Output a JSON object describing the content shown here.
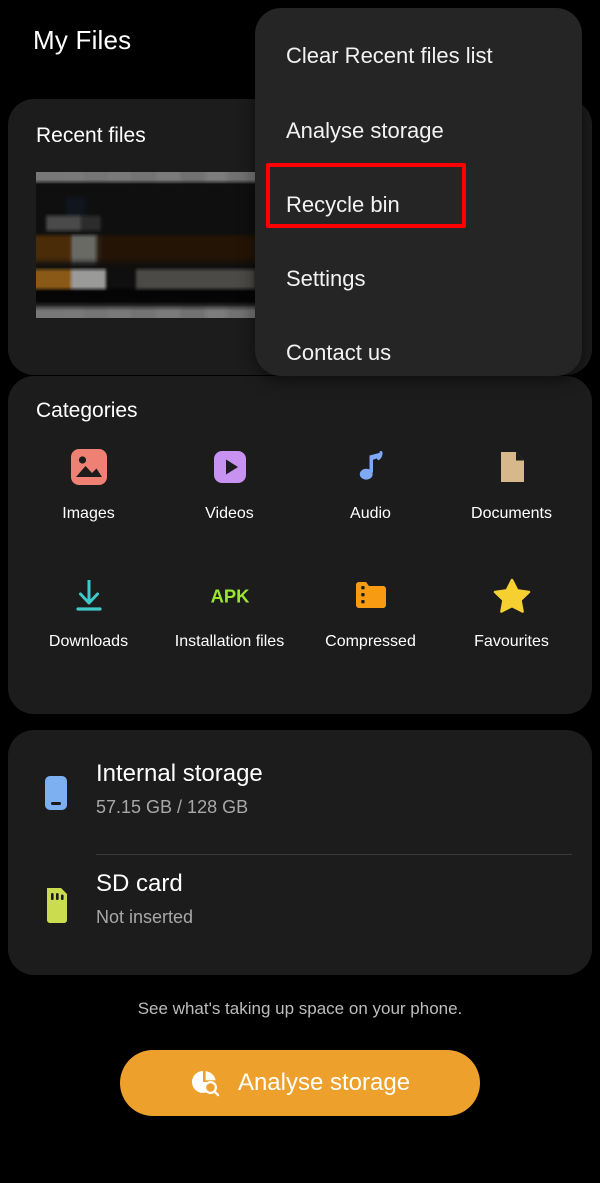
{
  "header": {
    "title": "My Files"
  },
  "recent": {
    "title": "Recent files",
    "thumbnail_icon": "blurred-thumbnail-strip"
  },
  "menu": {
    "items": [
      {
        "label": "Clear Recent files list",
        "name": "menu-item-clear-recent-files-list"
      },
      {
        "label": "Analyse storage",
        "name": "menu-item-analyse-storage"
      },
      {
        "label": "Recycle bin",
        "name": "menu-item-recycle-bin",
        "highlighted": true
      },
      {
        "label": "Settings",
        "name": "menu-item-settings"
      },
      {
        "label": "Contact us",
        "name": "menu-item-contact-us"
      }
    ],
    "highlight_color": "#ff0000",
    "background_color": "#252525"
  },
  "categories": {
    "title": "Categories",
    "items": [
      {
        "label": "Images",
        "icon": "image-icon",
        "color": "#ef8174"
      },
      {
        "label": "Videos",
        "icon": "video-play-icon",
        "color": "#c792f0"
      },
      {
        "label": "Audio",
        "icon": "music-note-icon",
        "color": "#7fa8f5"
      },
      {
        "label": "Documents",
        "icon": "document-icon",
        "color": "#d6b88a"
      },
      {
        "label": "Downloads",
        "icon": "download-icon",
        "color": "#3fc9c9"
      },
      {
        "label": "Installation files",
        "icon": "apk-icon",
        "color": "#9ae62e"
      },
      {
        "label": "Compressed",
        "icon": "compressed-folder-icon",
        "color": "#f79c12"
      },
      {
        "label": "Favourites",
        "icon": "star-icon",
        "color": "#f6d031"
      }
    ]
  },
  "storage": {
    "rows": [
      {
        "name": "Internal storage",
        "detail": "57.15 GB / 128 GB",
        "icon": "phone-icon",
        "icon_color": "#7cb0f0"
      },
      {
        "name": "SD card",
        "detail": "Not inserted",
        "icon": "sd-card-icon",
        "icon_color": "#cbdd4f"
      }
    ]
  },
  "footer": {
    "note": "See what's taking up space on your phone.",
    "button_label": "Analyse storage",
    "button_icon": "pie-chart-search-icon",
    "button_color": "#eea02c"
  }
}
